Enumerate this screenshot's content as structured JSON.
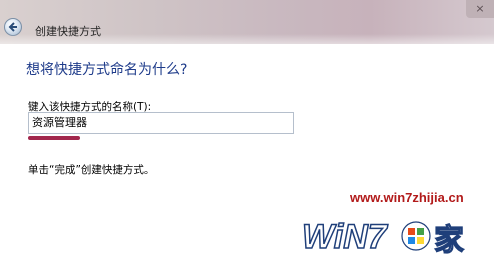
{
  "window": {
    "title": "创建快捷方式",
    "close_label": "×"
  },
  "page": {
    "heading": "想将快捷方式命名为什么?",
    "field_label": "键入该快捷方式的名称(T):",
    "name_value": "资源管理器",
    "hint": "单击“完成”创建快捷方式。"
  },
  "watermark": {
    "url": "www.win7zhijia.cn",
    "brand": "WiN7",
    "brand_suffix": "家"
  },
  "colors": {
    "heading": "#1e3b8a",
    "accent": "#a2274d",
    "watermark": "#b21a1a"
  }
}
